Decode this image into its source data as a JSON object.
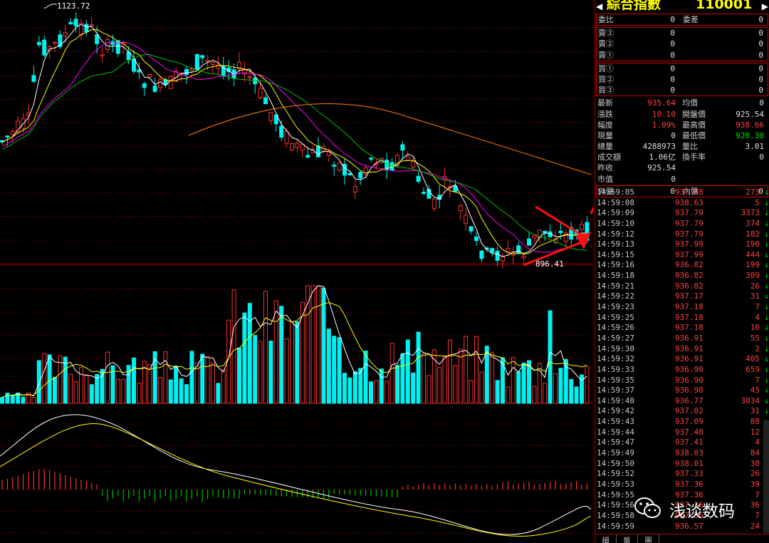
{
  "chart": {
    "max_label": "1123.72",
    "min_label": "896.41",
    "colors": {
      "up": "#ff3030",
      "down": "#00f0f0",
      "ma5": "#ffffff",
      "ma10": "#ffff00",
      "ma20": "#ff00ff",
      "ma30": "#00c000",
      "ma60": "#ff8000",
      "grid": "#b00000"
    }
  },
  "panel": {
    "title": "綜合指數",
    "code": "110001",
    "arrow_left": "◀",
    "arrow_right": "▶",
    "top_box": [
      {
        "l1": "委比",
        "v1": "0",
        "l2": "委差",
        "v2": "0"
      }
    ],
    "sell_box": [
      {
        "l": "賣③",
        "p": "0",
        "q": "0"
      },
      {
        "l": "賣②",
        "p": "0",
        "q": "0"
      },
      {
        "l": "賣①",
        "p": "0",
        "q": "0"
      }
    ],
    "buy_box": [
      {
        "l": "買①",
        "p": "0",
        "q": "0"
      },
      {
        "l": "買②",
        "p": "0",
        "q": "0"
      },
      {
        "l": "買③",
        "p": "0",
        "q": "0"
      }
    ],
    "stats": [
      {
        "l1": "最新",
        "v1": "935.64",
        "c1": "red",
        "l2": "均價",
        "v2": "0",
        "c2": "white"
      },
      {
        "l1": "漲跌",
        "v1": "10.10",
        "c1": "red",
        "l2": "開盤價",
        "v2": "925.54",
        "c2": "white"
      },
      {
        "l1": "幅度",
        "v1": "1.09%",
        "c1": "red",
        "l2": "最高價",
        "v2": "938.66",
        "c2": "red"
      },
      {
        "l1": "現量",
        "v1": "0",
        "c1": "white",
        "l2": "最低價",
        "v2": "920.30",
        "c2": "green"
      },
      {
        "l1": "總量",
        "v1": "4288973",
        "c1": "white",
        "l2": "量比",
        "v2": "3.01",
        "c2": "white"
      },
      {
        "l1": "成交額",
        "v1": "1.06亿",
        "c1": "white",
        "l2": "換手率",
        "v2": "0",
        "c2": "white"
      },
      {
        "l1": "昨收",
        "v1": "925.54",
        "c1": "white",
        "l2": "",
        "v2": "",
        "c2": "white"
      },
      {
        "l1": "市值",
        "v1": "0",
        "c1": "white",
        "l2": "",
        "v2": "",
        "c2": "white"
      }
    ],
    "outer_inner": {
      "l1": "外盤",
      "v1": "0",
      "l2": "內盤",
      "v2": "0"
    },
    "ticks": [
      {
        "t": "14:59:05",
        "p": "937.08",
        "q": "273"
      },
      {
        "t": "14:59:08",
        "p": "938.63",
        "q": "5"
      },
      {
        "t": "14:59:09",
        "p": "937.79",
        "q": "3373"
      },
      {
        "t": "14:59:10",
        "p": "937.79",
        "q": "374"
      },
      {
        "t": "14:59:12",
        "p": "937.79",
        "q": "182"
      },
      {
        "t": "14:59:13",
        "p": "937.99",
        "q": "190"
      },
      {
        "t": "14:59:15",
        "p": "937.99",
        "q": "444"
      },
      {
        "t": "14:59:16",
        "p": "936.82",
        "q": "199"
      },
      {
        "t": "14:59:18",
        "p": "936.82",
        "q": "309"
      },
      {
        "t": "14:59:21",
        "p": "936.82",
        "q": "26"
      },
      {
        "t": "14:59:22",
        "p": "937.17",
        "q": "31"
      },
      {
        "t": "14:59:23",
        "p": "937.18",
        "q": "7"
      },
      {
        "t": "14:59:25",
        "p": "937.18",
        "q": "4"
      },
      {
        "t": "14:59:26",
        "p": "937.18",
        "q": "10"
      },
      {
        "t": "14:59:27",
        "p": "936.91",
        "q": "55"
      },
      {
        "t": "14:59:30",
        "p": "936.91",
        "q": "2"
      },
      {
        "t": "14:59:32",
        "p": "936.91",
        "q": "405"
      },
      {
        "t": "14:59:33",
        "p": "936.90",
        "q": "659"
      },
      {
        "t": "14:59:35",
        "p": "936.90",
        "q": "7"
      },
      {
        "t": "14:59:37",
        "p": "936.90",
        "q": "45"
      },
      {
        "t": "14:59:40",
        "p": "936.77",
        "q": "3034"
      },
      {
        "t": "14:59:42",
        "p": "937.02",
        "q": "31"
      },
      {
        "t": "14:59:43",
        "p": "937.09",
        "q": "88"
      },
      {
        "t": "14:59:44",
        "p": "937.40",
        "q": "12"
      },
      {
        "t": "14:59:47",
        "p": "937.41",
        "q": "4"
      },
      {
        "t": "14:59:49",
        "p": "938.03",
        "q": "84"
      },
      {
        "t": "14:59:50",
        "p": "938.01",
        "q": "30"
      },
      {
        "t": "14:59:52",
        "p": "937.33",
        "q": "26"
      },
      {
        "t": "14:59:53",
        "p": "937.36",
        "q": "39"
      },
      {
        "t": "14:59:55",
        "p": "937.36",
        "q": "7"
      },
      {
        "t": "14:59:56",
        "p": "937.36",
        "q": "36"
      },
      {
        "t": "14:59:58",
        "p": "937.36",
        "q": "7"
      },
      {
        "t": "14:59:59",
        "p": "936.57",
        "q": "24"
      }
    ],
    "tabs": [
      "細",
      "盤",
      "圖"
    ]
  },
  "watermark": "浅谈数码"
}
